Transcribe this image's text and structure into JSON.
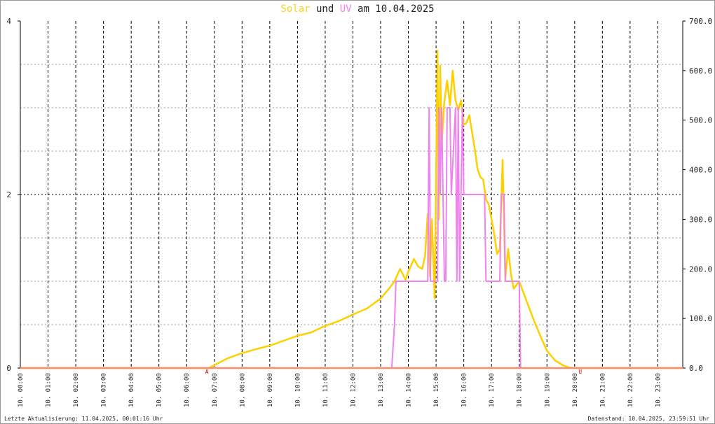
{
  "title": {
    "solar": "Solar",
    "und": "und",
    "uv": "UV",
    "rest": "am 10.04.2025"
  },
  "footer": {
    "left": "Letzte Aktualisierung: 11.04.2025, 00:01:16 Uhr",
    "right": "Datenstand: 10.04.2025, 23:59:51 Uhr"
  },
  "markers": {
    "sunrise": {
      "label": "A",
      "hour": 6.73
    },
    "sunset": {
      "label": "U",
      "hour": 20.2
    }
  },
  "colors": {
    "solar": "#ffd000",
    "uv": "#ee82ee",
    "baseline": "#ff8c69",
    "grid": "#000000",
    "marker": "#cc0000"
  },
  "chart_data": {
    "type": "line",
    "xlim": [
      0,
      23.9
    ],
    "x_tick_labels": [
      "10. 00:00",
      "10. 01:00",
      "10. 02:00",
      "10. 03:00",
      "10. 04:00",
      "10. 05:00",
      "10. 06:00",
      "10. 07:00",
      "10. 08:00",
      "10. 09:00",
      "10. 10:00",
      "10. 11:00",
      "10. 12:00",
      "10. 13:00",
      "10. 14:00",
      "10. 15:00",
      "10. 16:00",
      "10. 17:00",
      "10. 18:00",
      "10. 19:00",
      "10. 20:00",
      "10. 21:00",
      "10. 22:00",
      "10. 23:00"
    ],
    "left_axis": {
      "ylim": [
        0,
        4
      ],
      "ticks": [
        "0",
        "2",
        "4"
      ]
    },
    "right_axis": {
      "ylim": [
        0,
        700
      ],
      "ticks": [
        "0.0",
        "100.0",
        "200.0",
        "300.0",
        "400.0",
        "500.0",
        "600.0",
        "700.0"
      ]
    },
    "grid": true,
    "series": [
      {
        "name": "Solar",
        "axis": "right",
        "x": [
          0,
          6.8,
          7.0,
          7.5,
          8.0,
          8.5,
          9.0,
          9.5,
          10.0,
          10.5,
          11.0,
          11.5,
          12.0,
          12.5,
          13.0,
          13.3,
          13.5,
          13.7,
          13.9,
          14.0,
          14.2,
          14.35,
          14.5,
          14.6,
          14.7,
          14.78,
          14.85,
          14.95,
          15.05,
          15.1,
          15.15,
          15.2,
          15.3,
          15.4,
          15.5,
          15.6,
          15.7,
          15.8,
          15.9,
          16.0,
          16.1,
          16.2,
          16.4,
          16.5,
          16.6,
          16.7,
          16.8,
          16.9,
          17.0,
          17.1,
          17.2,
          17.3,
          17.4,
          17.5,
          17.6,
          17.7,
          17.8,
          18.0,
          18.2,
          18.5,
          18.8,
          19.0,
          19.3,
          19.6,
          19.8,
          20.0,
          20.1,
          23.9
        ],
        "y": [
          0,
          0,
          6,
          20,
          30,
          38,
          45,
          55,
          65,
          72,
          85,
          95,
          108,
          120,
          140,
          160,
          175,
          200,
          178,
          195,
          220,
          205,
          200,
          225,
          310,
          185,
          300,
          140,
          640,
          300,
          610,
          450,
          540,
          580,
          530,
          600,
          540,
          520,
          540,
          490,
          495,
          510,
          440,
          400,
          385,
          380,
          340,
          330,
          300,
          270,
          230,
          240,
          420,
          180,
          240,
          190,
          160,
          175,
          145,
          100,
          60,
          35,
          15,
          5,
          1,
          0,
          0,
          0
        ]
      },
      {
        "name": "UV",
        "axis": "left",
        "x": [
          0,
          13.4,
          13.5,
          13.55,
          14.7,
          14.75,
          14.8,
          15.05,
          15.1,
          15.15,
          15.2,
          15.3,
          15.35,
          15.4,
          15.5,
          15.55,
          15.7,
          15.75,
          15.8,
          15.85,
          15.95,
          16.0,
          16.75,
          16.8,
          17.3,
          17.35,
          17.45,
          17.5,
          18.0,
          18.05,
          23.9
        ],
        "y": [
          0,
          0,
          0.5,
          1,
          1,
          3,
          1,
          1,
          3,
          2,
          3,
          1,
          1,
          3,
          3,
          2,
          3,
          1,
          3,
          1,
          3,
          2,
          2,
          1,
          1,
          2,
          2,
          1,
          1,
          0,
          0
        ]
      }
    ]
  }
}
